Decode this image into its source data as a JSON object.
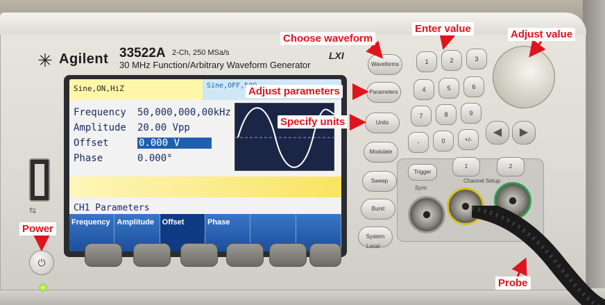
{
  "instrument": {
    "brand": "Agilent",
    "logo_icon": "agilent-spark-icon",
    "model": "33522A",
    "specs": "2-Ch, 250 MSa/s",
    "description": "30 MHz Function/Arbitrary Waveform Generator",
    "lxi_mark": "LXI"
  },
  "screen": {
    "ch1_tab": "Sine,ON,HiZ",
    "ch2_tab": "Sine,OFF,50Ω",
    "params": [
      {
        "label": "Frequency",
        "value": "50,000,000,00kHz"
      },
      {
        "label": "Amplitude",
        "value": "20.00 Vpp"
      },
      {
        "label": "Offset",
        "value": "0.000 V"
      },
      {
        "label": "Phase",
        "value": "0.000°"
      }
    ],
    "menu_title": "CH1 Parameters",
    "softkeys": [
      "Frequency",
      "Amplitude",
      "Offset",
      "Phase",
      "",
      ""
    ],
    "active_softkey": "Offset"
  },
  "panel": {
    "buttons": {
      "waveforms": "Waveforms",
      "parameters": "Parameters",
      "units": "Units",
      "modulate": "Modulate",
      "sweep": "Sweep",
      "burst": "Burst",
      "system": "System",
      "local": "Local",
      "trigger": "Trigger",
      "sync": "Sync",
      "channel_setup": "Channel Setup",
      "ch1": "1",
      "ch2": "2"
    },
    "keypad": [
      "1",
      "2",
      "3",
      "4",
      "5",
      "6",
      "7",
      "8",
      "9",
      "-",
      "0",
      "+/-"
    ],
    "left_arrow_icon": "left-arrow-icon",
    "right_arrow_icon": "right-arrow-icon",
    "knob_icon": "rotary-knob-icon",
    "usb_icon": "usb-icon",
    "power_icon": "power-icon"
  },
  "annotations": {
    "choose_waveform": "Choose waveform",
    "enter_value": "Enter value",
    "adjust_value": "Adjust value",
    "adjust_parameters": "Adjust parameters",
    "specify_units": "Specify units",
    "power": "Power",
    "probe": "Probe",
    "color": "#e0141e"
  }
}
